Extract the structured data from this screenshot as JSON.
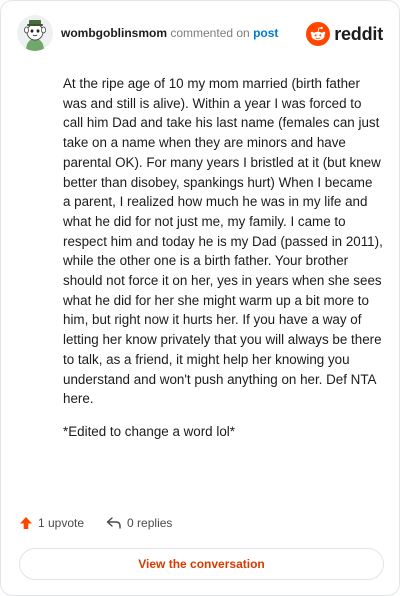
{
  "comment": {
    "username": "wombgoblinsmom",
    "action_text": "commented on",
    "target_text": "post",
    "paragraphs": [
      "At the ripe age of 10 my mom married (birth father was and still is alive). Within a year I was forced to call him Dad and take his last name (females can just take on a name when they are minors and have parental OK). For many years I bristled at it (but knew better than disobey, spankings hurt) When I became a parent, I realized how much he was in my life and what he did for not just me, my family. I came to respect him and today he is my Dad (passed in 2011), while the other one is a birth father. Your brother should not force it on her, yes in years when she sees what he did for her she might warm up a bit more to him, but right now it hurts her. If you have a way of letting her know privately that you will always be there to talk, as a friend, it might help her knowing you understand and won't push anything on her. Def NTA here.",
      "*Edited to change a word lol*"
    ],
    "upvotes_label": "1 upvote",
    "replies_label": "0 replies"
  },
  "brand": {
    "wordmark": "reddit",
    "icon": "reddit-logo-icon",
    "color": "#ff4500"
  },
  "cta": {
    "label": "View the conversation",
    "color": "#d93a00"
  },
  "colors": {
    "link": "#0079d3",
    "muted": "#7c7c7c",
    "upvote": "#ff4500"
  }
}
